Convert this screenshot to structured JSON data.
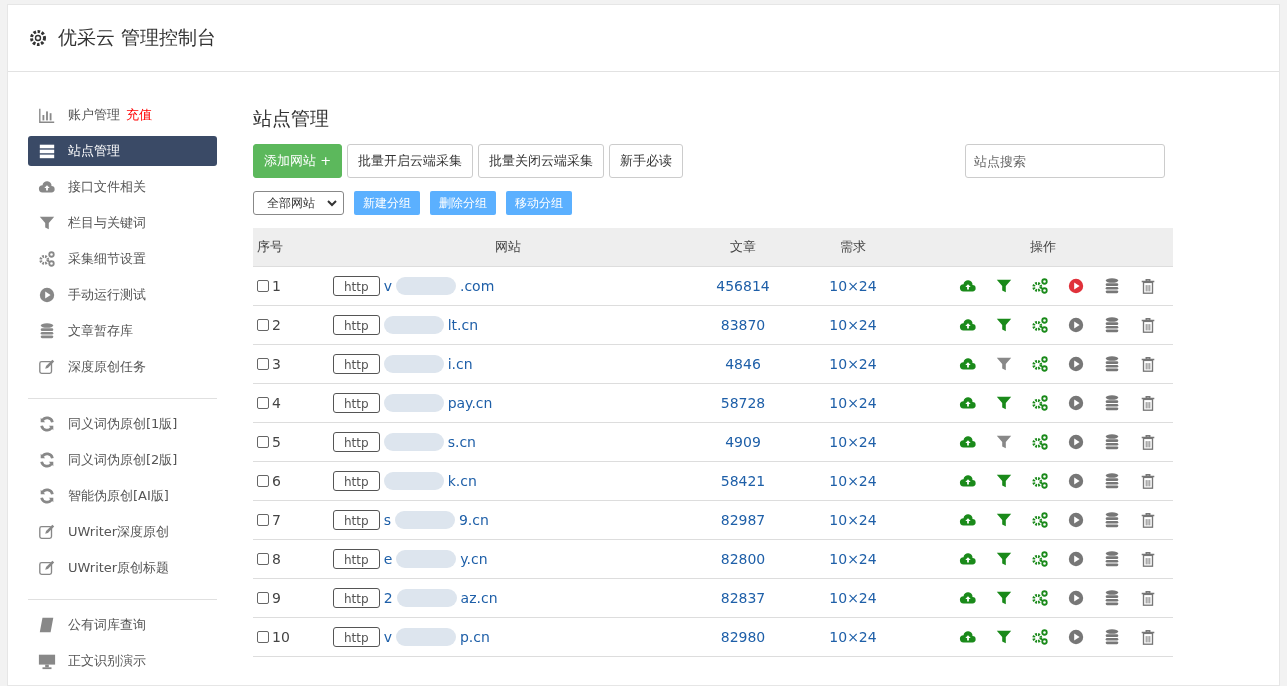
{
  "header": {
    "title": "优采云 管理控制台"
  },
  "sidebar": {
    "groups": [
      [
        {
          "label": "账户管理",
          "badge": "充值",
          "selected": false
        },
        {
          "label": "站点管理",
          "selected": true
        },
        {
          "label": "接口文件相关",
          "selected": false
        },
        {
          "label": "栏目与关键词",
          "selected": false
        },
        {
          "label": "采集细节设置",
          "selected": false
        },
        {
          "label": "手动运行测试",
          "selected": false
        },
        {
          "label": "文章暂存库",
          "selected": false
        },
        {
          "label": "深度原创任务",
          "selected": false
        }
      ],
      [
        {
          "label": "同义词伪原创[1版]",
          "selected": false
        },
        {
          "label": "同义词伪原创[2版]",
          "selected": false
        },
        {
          "label": "智能伪原创[AI版]",
          "selected": false
        },
        {
          "label": "UWriter深度原创",
          "selected": false
        },
        {
          "label": "UWriter原创标题",
          "selected": false
        }
      ],
      [
        {
          "label": "公有词库查询",
          "selected": false
        },
        {
          "label": "正文识别演示",
          "selected": false
        }
      ]
    ]
  },
  "main": {
    "title": "站点管理",
    "toolbar": [
      {
        "kind": "primary",
        "label": "添加网站 +"
      },
      {
        "kind": "outline",
        "label": "批量开启云端采集"
      },
      {
        "kind": "outline",
        "label": "批量关闭云端采集"
      },
      {
        "kind": "outline",
        "label": "新手必读"
      }
    ],
    "search": {
      "placeholder": "站点搜索"
    },
    "group_select": {
      "value": "全部网站"
    },
    "group_buttons": [
      "新建分组",
      "删除分组",
      "移动分组"
    ],
    "table": {
      "columns": [
        "序号",
        "网站",
        "文章",
        "需求",
        "操作"
      ],
      "rows": [
        {
          "checked": false,
          "index": "1",
          "scheme": "http",
          "site_prefix": "v",
          "site_suffix": ".com",
          "articles": "456814",
          "demand": "10×24",
          "filter_on": true,
          "running": true
        },
        {
          "checked": false,
          "index": "2",
          "scheme": "http",
          "site_suffix": "lt.cn",
          "articles": "83870",
          "demand": "10×24",
          "filter_on": true,
          "running": false
        },
        {
          "checked": false,
          "index": "3",
          "scheme": "http",
          "site_suffix": "i.cn",
          "articles": "4846",
          "demand": "10×24",
          "filter_on": false,
          "running": false
        },
        {
          "checked": false,
          "index": "4",
          "scheme": "http",
          "site_suffix": "pay.cn",
          "articles": "58728",
          "demand": "10×24",
          "filter_on": true,
          "running": false
        },
        {
          "checked": false,
          "index": "5",
          "scheme": "http",
          "site_suffix": "s.cn",
          "articles": "4909",
          "demand": "10×24",
          "filter_on": false,
          "running": false
        },
        {
          "checked": false,
          "index": "6",
          "scheme": "http",
          "site_suffix": "k.cn",
          "articles": "58421",
          "demand": "10×24",
          "filter_on": true,
          "running": false
        },
        {
          "checked": false,
          "index": "7",
          "scheme": "http",
          "site_prefix": "s",
          "site_suffix": "9.cn",
          "articles": "82987",
          "demand": "10×24",
          "filter_on": true,
          "running": false
        },
        {
          "checked": false,
          "index": "8",
          "scheme": "http",
          "site_prefix": "e",
          "site_suffix": "y.cn",
          "articles": "82800",
          "demand": "10×24",
          "filter_on": true,
          "running": false
        },
        {
          "checked": false,
          "index": "9",
          "scheme": "http",
          "site_prefix": "2",
          "site_suffix": "az.cn",
          "articles": "82837",
          "demand": "10×24",
          "filter_on": true,
          "running": false
        },
        {
          "checked": false,
          "index": "10",
          "scheme": "http",
          "site_prefix": "v",
          "site_suffix": "p.cn",
          "articles": "82980",
          "demand": "10×24",
          "filter_on": true,
          "running": false
        }
      ]
    }
  }
}
